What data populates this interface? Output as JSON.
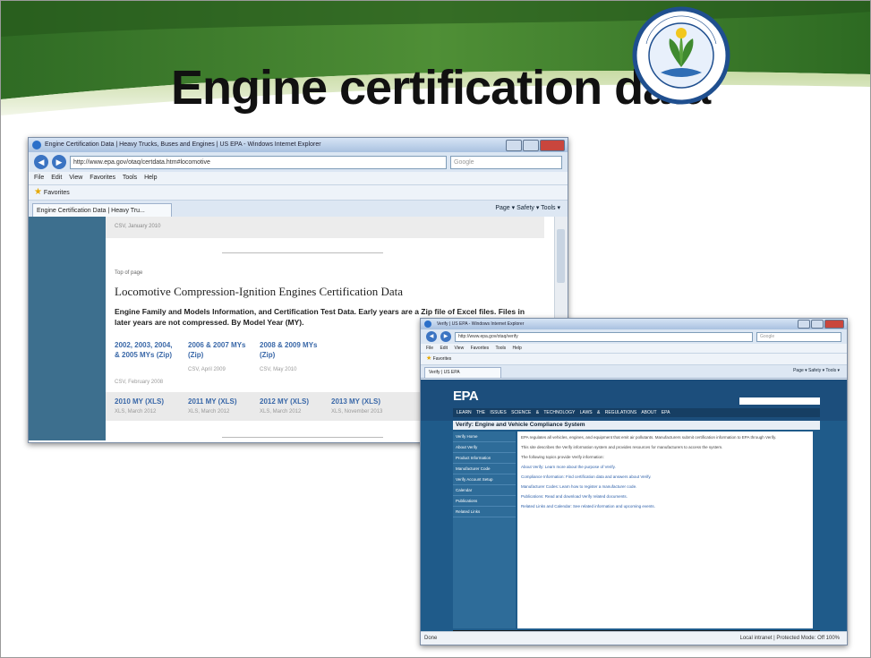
{
  "slide": {
    "title": "Engine certification data",
    "seal_text": "UNITED STATES · ENVIRONMENTAL PROTECTION AGENCY"
  },
  "colors": {
    "banner_green": "#3a7a2c",
    "epa_blue": "#1f5b8a",
    "sidebar_blue": "#3d6f8e"
  },
  "window1": {
    "title": "Engine Certification Data | Heavy Trucks, Buses and Engines | US EPA - Windows Internet Explorer",
    "url": "http://www.epa.gov/otaq/certdata.htm#locomotive",
    "search_placeholder": "Google",
    "menu": "File Edit View Favorites Tools Help",
    "favorites_label": "Favorites",
    "tab_label": "Engine Certification Data | Heavy Tru...",
    "command_bar": "Page ▾  Safety ▾  Tools ▾",
    "top_row_text": "CSV, January 2010",
    "top_of_page": "Top of page",
    "heading": "Locomotive Compression-Ignition Engines Certification Data",
    "intro": "Engine Family and Models Information, and Certification Test Data. Early years are a Zip file of Excel files. Files in later years are not compressed. By Model Year (MY).",
    "years": [
      {
        "label": "2002, 2003, 2004, & 2005 MYs (Zip)",
        "sub": "CSV, February 2008"
      },
      {
        "label": "2006 & 2007 MYs (Zip)",
        "sub": "CSV, April 2009"
      },
      {
        "label": "2008 & 2009 MYs (Zip)",
        "sub": "CSV, May 2010"
      }
    ],
    "years2": [
      {
        "label": "2010 MY (XLS)",
        "sub": "XLS, March 2012"
      },
      {
        "label": "2011 MY (XLS)",
        "sub": "XLS, March 2012"
      },
      {
        "label": "2012 MY (XLS)",
        "sub": "XLS, March 2012"
      },
      {
        "label": "2013 MY (XLS)",
        "sub": "XLS, November 2013"
      }
    ]
  },
  "window2": {
    "title": "Verify | US EPA - Windows Internet Explorer",
    "url": "http://www.epa.gov/otaq/verify",
    "search_placeholder": "Google",
    "menu": "File Edit View Favorites Tools Help",
    "favorites_label": "Favorites",
    "tab_label": "Verify | US EPA",
    "command_bar": "Page ▾  Safety ▾  Tools ▾",
    "logo": "EPA",
    "nav": "LEARN THE ISSUES   SCIENCE & TECHNOLOGY   LAWS & REGULATIONS   ABOUT EPA",
    "section_title": "Verify: Engine and Vehicle Compliance System",
    "left_nav": [
      "Verify Home",
      "About Verify",
      "Product Information",
      "Manufacturer Code",
      "Verify Account Setup",
      "Calendar",
      "Publications",
      "Related Links"
    ],
    "para1": "EPA regulates all vehicles, engines, and equipment that emit air pollutants. Manufacturers submit certification information to EPA through Verify.",
    "para2": "This site describes the Verify information system and provides resources for manufacturers to access the system.",
    "para3": "The following topics provide Verify information:",
    "bullets": [
      "About Verify: Learn more about the purpose of Verify.",
      "Compliance Information: Find certification data and answers about Verify.",
      "Manufacturer Codes: Learn how to register a manufacturer code.",
      "Publications: Read and download Verify related documents.",
      "Related Links and Calendar: See related information and upcoming events."
    ],
    "status_left": "Done",
    "status_right": "Local intranet | Protected Mode: Off   100%"
  }
}
